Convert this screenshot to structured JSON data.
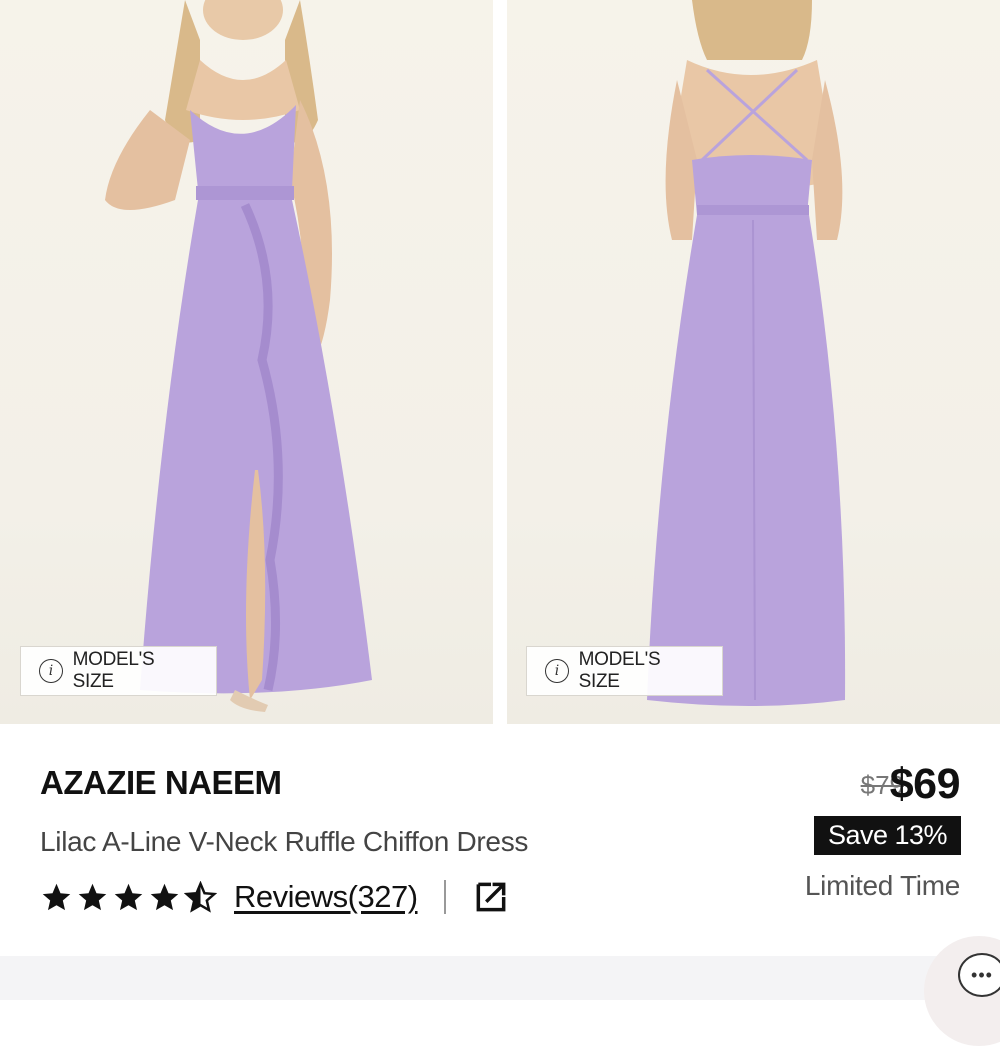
{
  "gallery": {
    "images": [
      {
        "name": "front-view",
        "dress_color": "#b9a3dc"
      },
      {
        "name": "back-view",
        "dress_color": "#b9a3dc"
      }
    ],
    "model_size_label": "MODEL'S SIZE"
  },
  "product": {
    "brand": "AZAZIE NAEEM",
    "name": "Lilac A-Line V-Neck Ruffle Chiffon Dress",
    "rating": 4.5,
    "rating_max": 5,
    "reviews_label": "Reviews(327)"
  },
  "pricing": {
    "original_price": "$79",
    "current_price": "$69",
    "save_label": "Save 13%",
    "promo_note": "Limited Time"
  },
  "icons": {
    "info": "info-icon",
    "share": "external-share-icon",
    "chat": "chat-icon",
    "star": "star-icon"
  },
  "colors": {
    "dress": "#b9a3dc",
    "badge_bg": "#111111",
    "accent_text": "#111111"
  }
}
